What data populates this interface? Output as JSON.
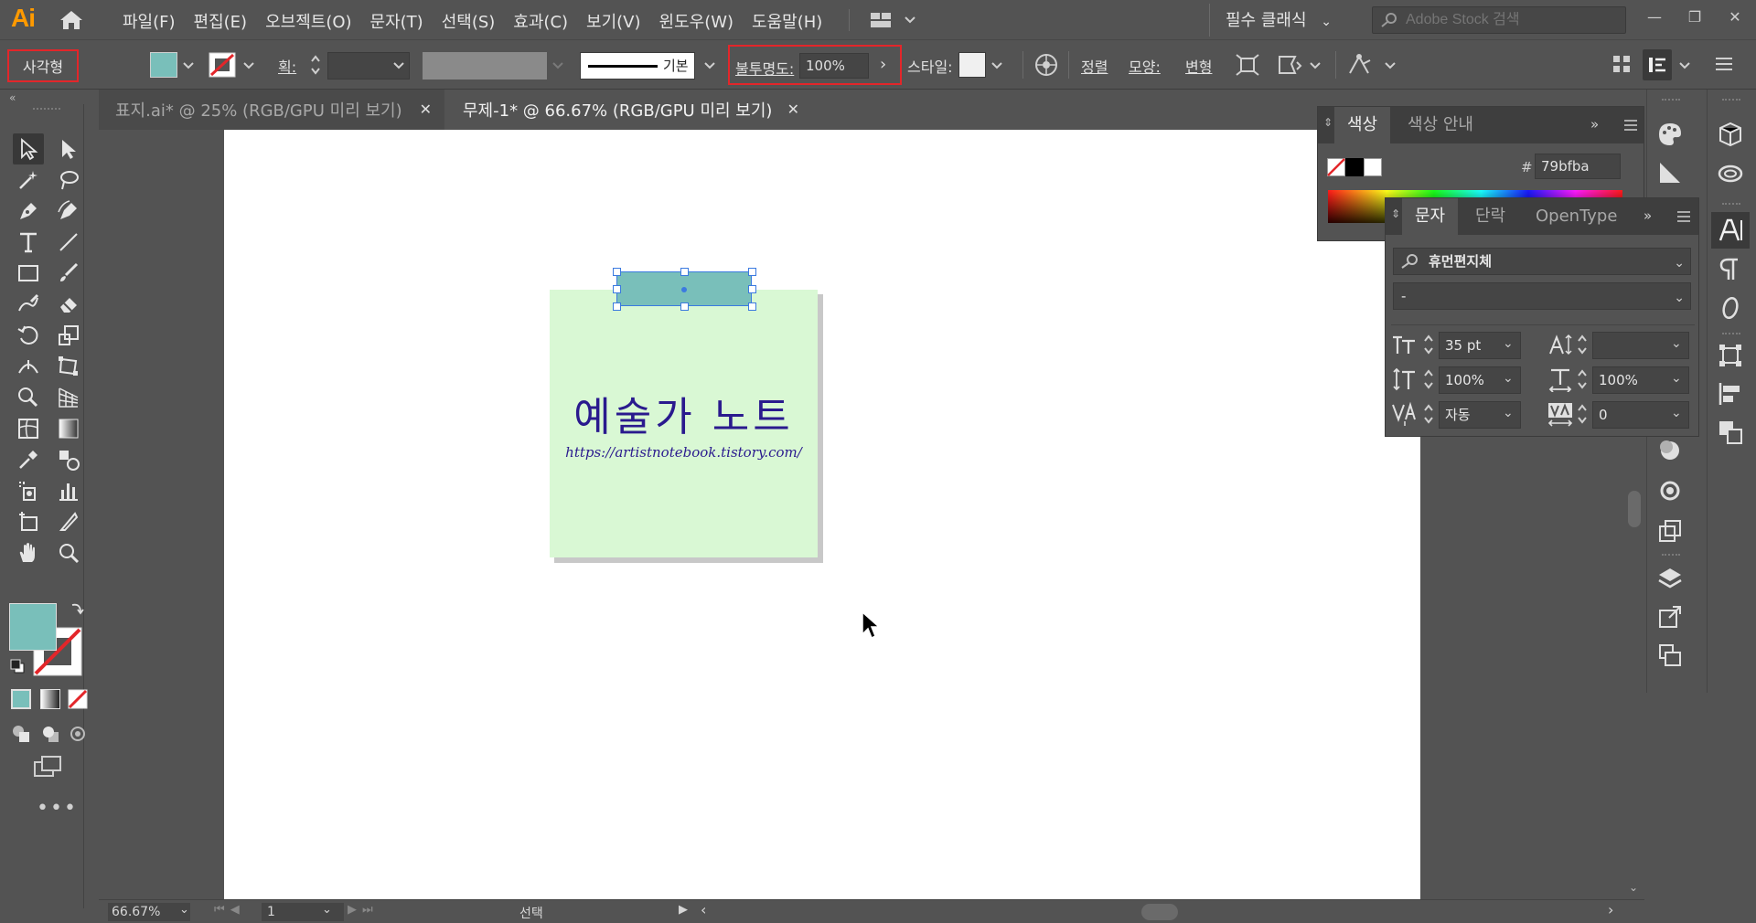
{
  "app": {
    "logo": "Ai",
    "menu": [
      "파일(F)",
      "편집(E)",
      "오브젝트(O)",
      "문자(T)",
      "선택(S)",
      "효과(C)",
      "보기(V)",
      "윈도우(W)",
      "도움말(H)"
    ],
    "workspace": "필수 클래식",
    "stock_placeholder": "Adobe Stock 검색"
  },
  "control_bar": {
    "selection_label": "사각형",
    "fill_color": "#79bfba",
    "stroke_label": "획:",
    "stroke_style": "기본",
    "opacity_label": "불투명도:",
    "opacity_value": "100%",
    "style_label": "스타일:",
    "align_label": "정렬",
    "shape_label": "모양:",
    "transform_label": "변형"
  },
  "tabs": [
    {
      "label": "표지.ai* @ 25% (RGB/GPU 미리 보기)",
      "active": false
    },
    {
      "label": "무제-1* @ 66.67% (RGB/GPU 미리 보기)",
      "active": true
    }
  ],
  "artwork": {
    "title": "예술가 노트",
    "url": "https://artistnotebook.tistory.com/",
    "note_color": "#d9f8d4",
    "tape_color": "#79bfba",
    "text_color": "#2a1a8e"
  },
  "status": {
    "zoom": "66.67%",
    "page": "1",
    "tool_name": "선택"
  },
  "color_panel": {
    "tabs": [
      "색상",
      "색상 안내"
    ],
    "hex_prefix": "#",
    "hex": "79bfba"
  },
  "type_panel": {
    "tabs": [
      "문자",
      "단락",
      "OpenType"
    ],
    "font_family": "휴먼편지체",
    "font_style": "-",
    "font_size": "35 pt",
    "leading": "",
    "vertical_scale": "100%",
    "horizontal_scale": "100%",
    "kerning": "자동",
    "tracking": "0"
  }
}
